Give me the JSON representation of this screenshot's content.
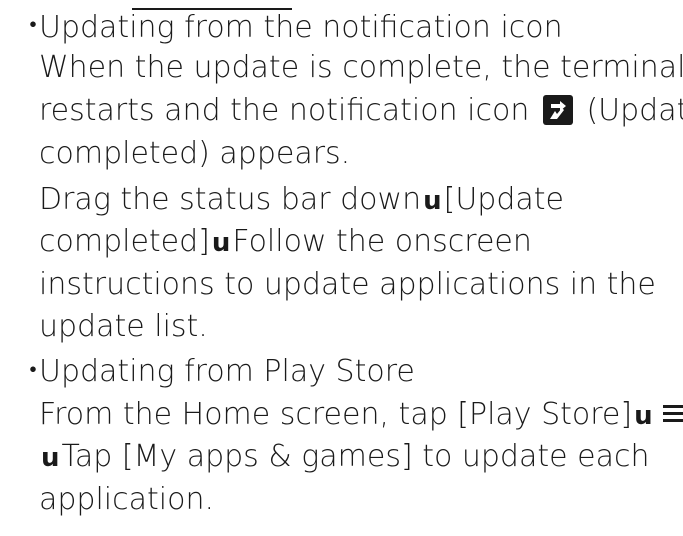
{
  "section1": {
    "heading": "Updating from the notification icon",
    "line1": "When the update is complete, the terminal",
    "line2a": "restarts and the notification icon",
    "line2b": "(Update",
    "line3": "completed) appears.",
    "line4a": "Drag the status bar down",
    "line4b": "[Update",
    "line5a": "completed]",
    "line5b": "Follow the onscreen",
    "line6": "instructions to update applications in the",
    "line7": "update list."
  },
  "section2": {
    "heading": "Updating from Play Store",
    "line1a": "From the Home screen, tap [Play Store]",
    "line2a": "Tap [My apps & games] to update each",
    "line3": "application."
  },
  "bullet": "・",
  "arrow": "u",
  "icons": {
    "update_completed": "update-completed-icon",
    "menu": "hamburger-menu-icon"
  }
}
